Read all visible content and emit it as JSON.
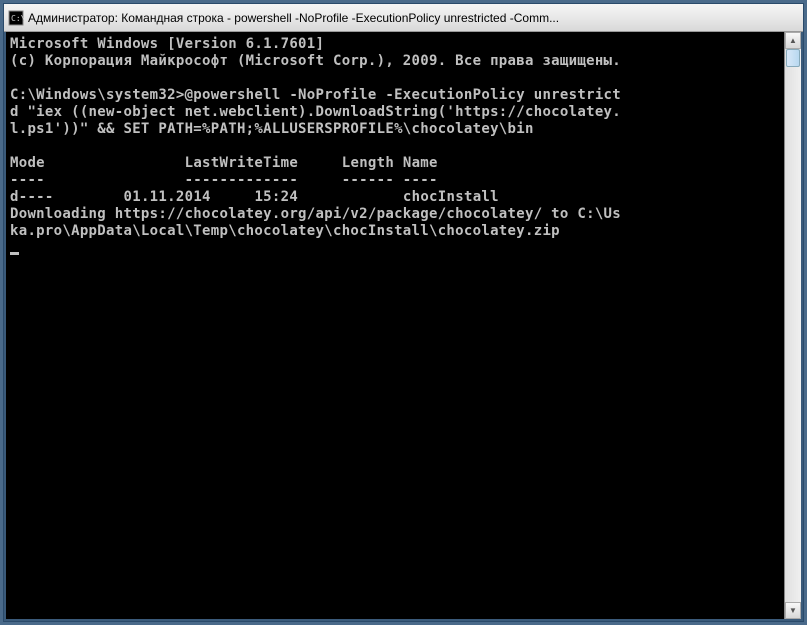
{
  "window": {
    "title": "Администратор: Командная строка - powershell  -NoProfile -ExecutionPolicy unrestricted -Comm..."
  },
  "console": {
    "line1": "Microsoft Windows [Version 6.1.7601]",
    "line2": "(c) Корпорация Майкрософт (Microsoft Corp.), 2009. Все права защищены.",
    "line3": "",
    "line4": "C:\\Windows\\system32>@powershell -NoProfile -ExecutionPolicy unrestrict",
    "line5": "d \"iex ((new-object net.webclient).DownloadString('https://chocolatey.",
    "line6": "l.ps1'))\" && SET PATH=%PATH;%ALLUSERSPROFILE%\\chocolatey\\bin",
    "line7": "",
    "headers": {
      "mode": "Mode",
      "lastWriteTime": "LastWriteTime",
      "length": "Length",
      "name": "Name"
    },
    "divider": "----                -------------     ------ ----",
    "row": {
      "mode": "d----",
      "date": "01.11.2014",
      "time": "15:24",
      "name": "chocInstall"
    },
    "line11": "Downloading https://chocolatey.org/api/v2/package/chocolatey/ to C:\\Us",
    "line12": "ka.pro\\AppData\\Local\\Temp\\chocolatey\\chocInstall\\chocolatey.zip"
  },
  "scrollbar": {
    "up": "▲",
    "down": "▼"
  }
}
